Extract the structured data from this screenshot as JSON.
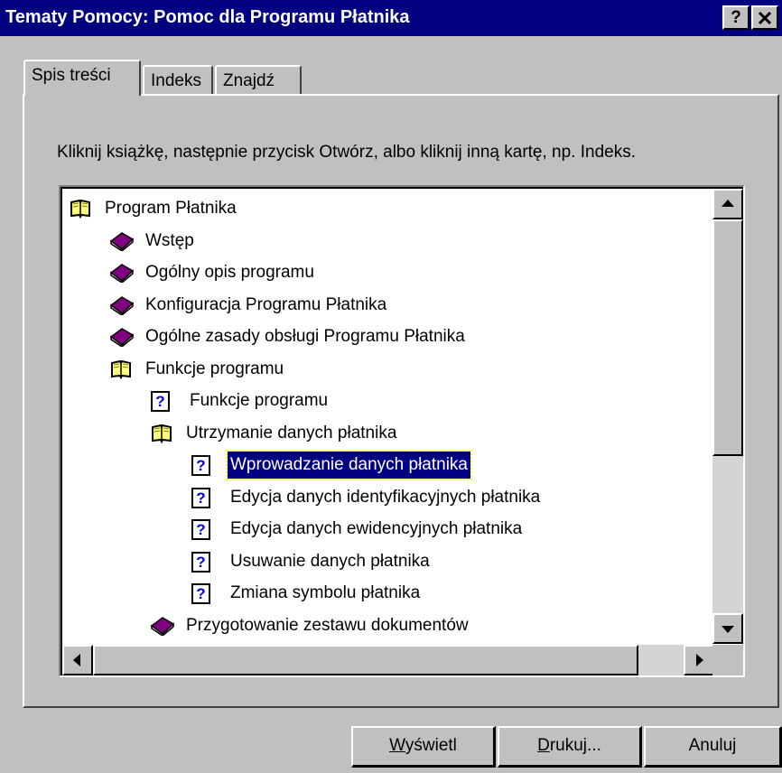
{
  "window": {
    "title": "Tematy Pomocy: Pomoc dla Programu Płatnika",
    "help_button": "?",
    "close_button": "×"
  },
  "tabs": [
    {
      "label": "Spis treści",
      "active": true
    },
    {
      "label": "Indeks",
      "active": false
    },
    {
      "label": "Znajdź",
      "active": false
    }
  ],
  "instruction": "Kliknij książkę, następnie przycisk Otwórz, albo kliknij inną kartę, np. Indeks.",
  "tree": {
    "items": [
      {
        "label": "Program Płatnika",
        "icon": "open-book-icon",
        "level": 0
      },
      {
        "label": "Wstęp",
        "icon": "closed-book-icon",
        "level": 1
      },
      {
        "label": "Ogólny opis programu",
        "icon": "closed-book-icon",
        "level": 1
      },
      {
        "label": "Konfiguracja Programu Płatnika",
        "icon": "closed-book-icon",
        "level": 1
      },
      {
        "label": "Ogólne zasady obsługi Programu Płatnika",
        "icon": "closed-book-icon",
        "level": 1
      },
      {
        "label": "Funkcje programu",
        "icon": "open-book-icon",
        "level": 1
      },
      {
        "label": "Funkcje programu",
        "icon": "help-topic-icon",
        "level": 2
      },
      {
        "label": "Utrzymanie danych płatnika",
        "icon": "open-book-icon",
        "level": 2
      },
      {
        "label": "Wprowadzanie danych płatnika",
        "icon": "help-topic-icon",
        "level": 3,
        "selected": true
      },
      {
        "label": "Edycja danych identyfikacyjnych płatnika",
        "icon": "help-topic-icon",
        "level": 3
      },
      {
        "label": "Edycja danych ewidencyjnych płatnika",
        "icon": "help-topic-icon",
        "level": 3
      },
      {
        "label": "Usuwanie danych płatnika",
        "icon": "help-topic-icon",
        "level": 3
      },
      {
        "label": "Zmiana symbolu płatnika",
        "icon": "help-topic-icon",
        "level": 3
      },
      {
        "label": "Przygotowanie zestawu dokumentów",
        "icon": "closed-book-icon",
        "level": 2
      },
      {
        "label": "",
        "icon": "closed-book-icon",
        "level": 2
      }
    ]
  },
  "buttons": {
    "display": {
      "mnemonic": "W",
      "rest": "yświetl"
    },
    "print": {
      "mnemonic": "D",
      "rest": "rukuj..."
    },
    "cancel": "Anuluj"
  },
  "colors": {
    "title_bar": "#000080",
    "selection": "#000080",
    "face": "#c0c0c0",
    "book_closed": "#800080",
    "book_open": "#ffff80"
  }
}
